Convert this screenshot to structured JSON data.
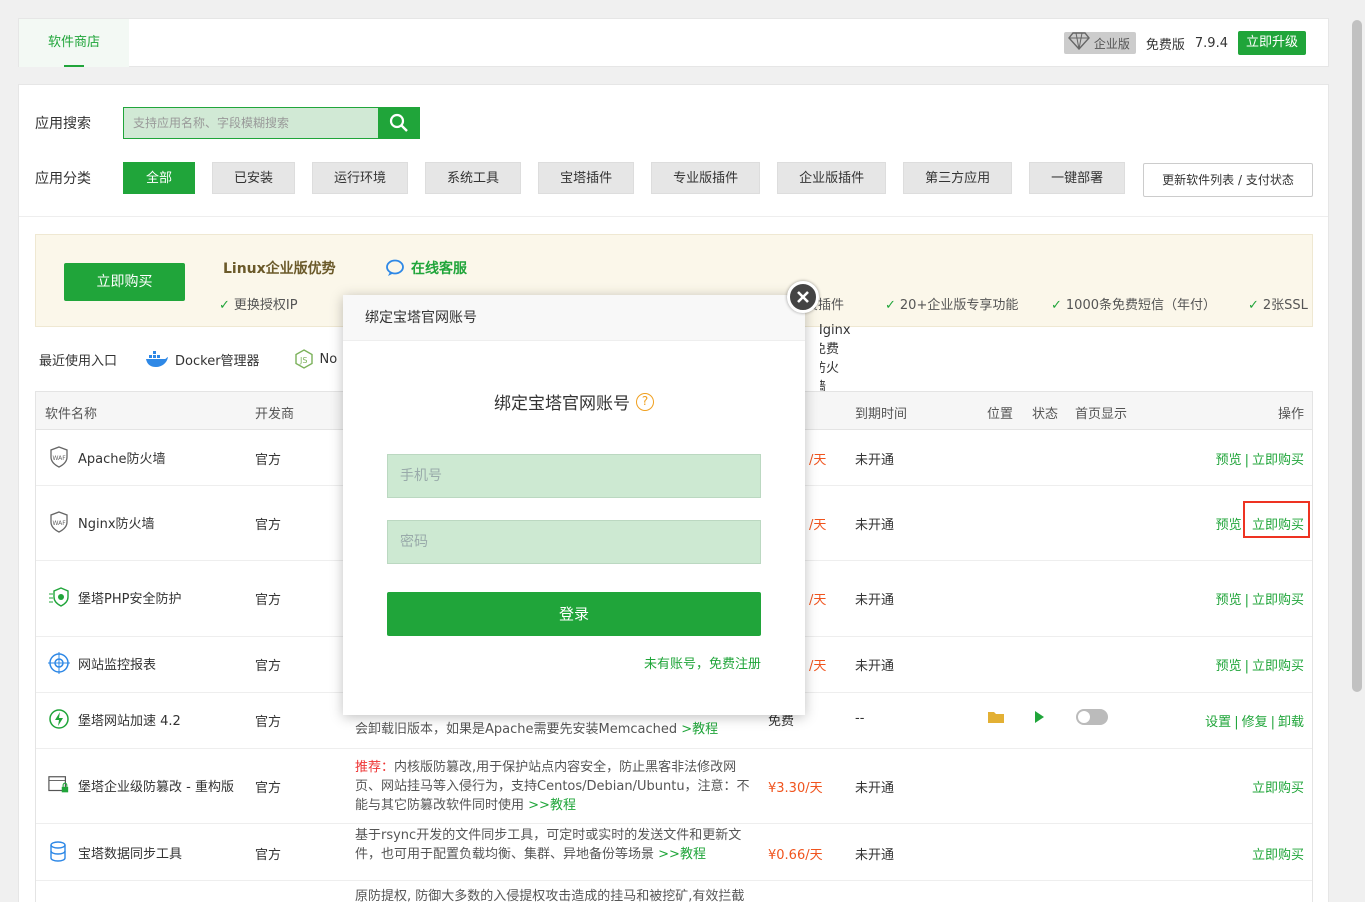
{
  "topbar": {
    "tab": "软件商店",
    "edition_badge": "企业版",
    "version_label": "免费版",
    "version": "7.9.4",
    "upgrade": "立即升级"
  },
  "search": {
    "label": "应用搜索",
    "placeholder": "支持应用名称、字段模糊搜索"
  },
  "categories": {
    "label": "应用分类",
    "items": [
      "全部",
      "已安装",
      "运行环境",
      "系统工具",
      "宝塔插件",
      "专业版插件",
      "企业版插件",
      "第三方应用",
      "一键部署"
    ],
    "refresh": "更新软件列表 / 支付状态"
  },
  "promo": {
    "buy": "立即购买",
    "title": "Linux企业版优势",
    "service": "在线客服",
    "features": [
      "更换授权IP",
      "费插件",
      "20+企业版专享功能",
      "1000条免费短信（年付）",
      "2张SSL"
    ]
  },
  "recent": {
    "label": "最近使用入口",
    "items": [
      "Docker管理器",
      "No",
      "Nginx免费防火墙"
    ]
  },
  "table": {
    "headers": [
      "软件名称",
      "开发商",
      "到期时间",
      "位置",
      "状态",
      "首页显示",
      "操作"
    ],
    "rows": [
      {
        "name": "Apache防火墙",
        "dev": "官方",
        "price": "/天",
        "expire": "未开通",
        "ops": [
          "预览",
          "立即购买"
        ]
      },
      {
        "name": "Nginx防火墙",
        "dev": "官方",
        "price": "/天",
        "expire": "未开通",
        "ops": [
          "预览",
          "立即购买"
        ]
      },
      {
        "name": "堡塔PHP安全防护",
        "dev": "官方",
        "price": "/天",
        "expire": "未开通",
        "ops": [
          "预览",
          "立即购买"
        ]
      },
      {
        "name": "网站监控报表",
        "dev": "官方",
        "price": "/天",
        "expire": "未开通",
        "ops": [
          "预览",
          "立即购买"
        ]
      },
      {
        "name": "堡塔网站加速 4.2",
        "dev": "官方",
        "desc": "会卸载旧版本，如果是Apache需要先安装Memcached",
        "desc_link": ">教程",
        "price": "免费",
        "expire": "--",
        "ops": [
          "设置",
          "修复",
          "卸载"
        ]
      },
      {
        "name": "堡塔企业级防篡改 - 重构版",
        "dev": "官方",
        "desc_tag": "推荐：",
        "desc": "内核版防篡改,用于保护站点内容安全，防止黑客非法修改网页、网站挂马等入侵行为，支持Centos/Debian/Ubuntu，注意：不能与其它防篡改软件同时使用",
        "desc_link": ">>教程",
        "price": "¥3.30/天",
        "expire": "未开通",
        "ops": [
          "立即购买"
        ]
      },
      {
        "name": "宝塔数据同步工具",
        "dev": "官方",
        "desc": "基于rsync开发的文件同步工具，可定时或实时的发送文件和更新文件，也可用于配置负载均衡、集群、异地备份等场景",
        "desc_link": ">>教程",
        "price": "¥0.66/天",
        "expire": "未开通",
        "ops": [
          "立即购买"
        ]
      },
      {
        "name": "",
        "dev": "",
        "desc": "原防提权, 防御大多数的入侵提权攻击造成的挂马和被挖矿,有效拦截",
        "price": "",
        "expire": "",
        "ops": []
      }
    ]
  },
  "modal": {
    "header": "绑定宝塔官网账号",
    "title": "绑定宝塔官网账号",
    "phone_placeholder": "手机号",
    "password_placeholder": "密码",
    "login": "登录",
    "register": "未有账号，免费注册"
  }
}
